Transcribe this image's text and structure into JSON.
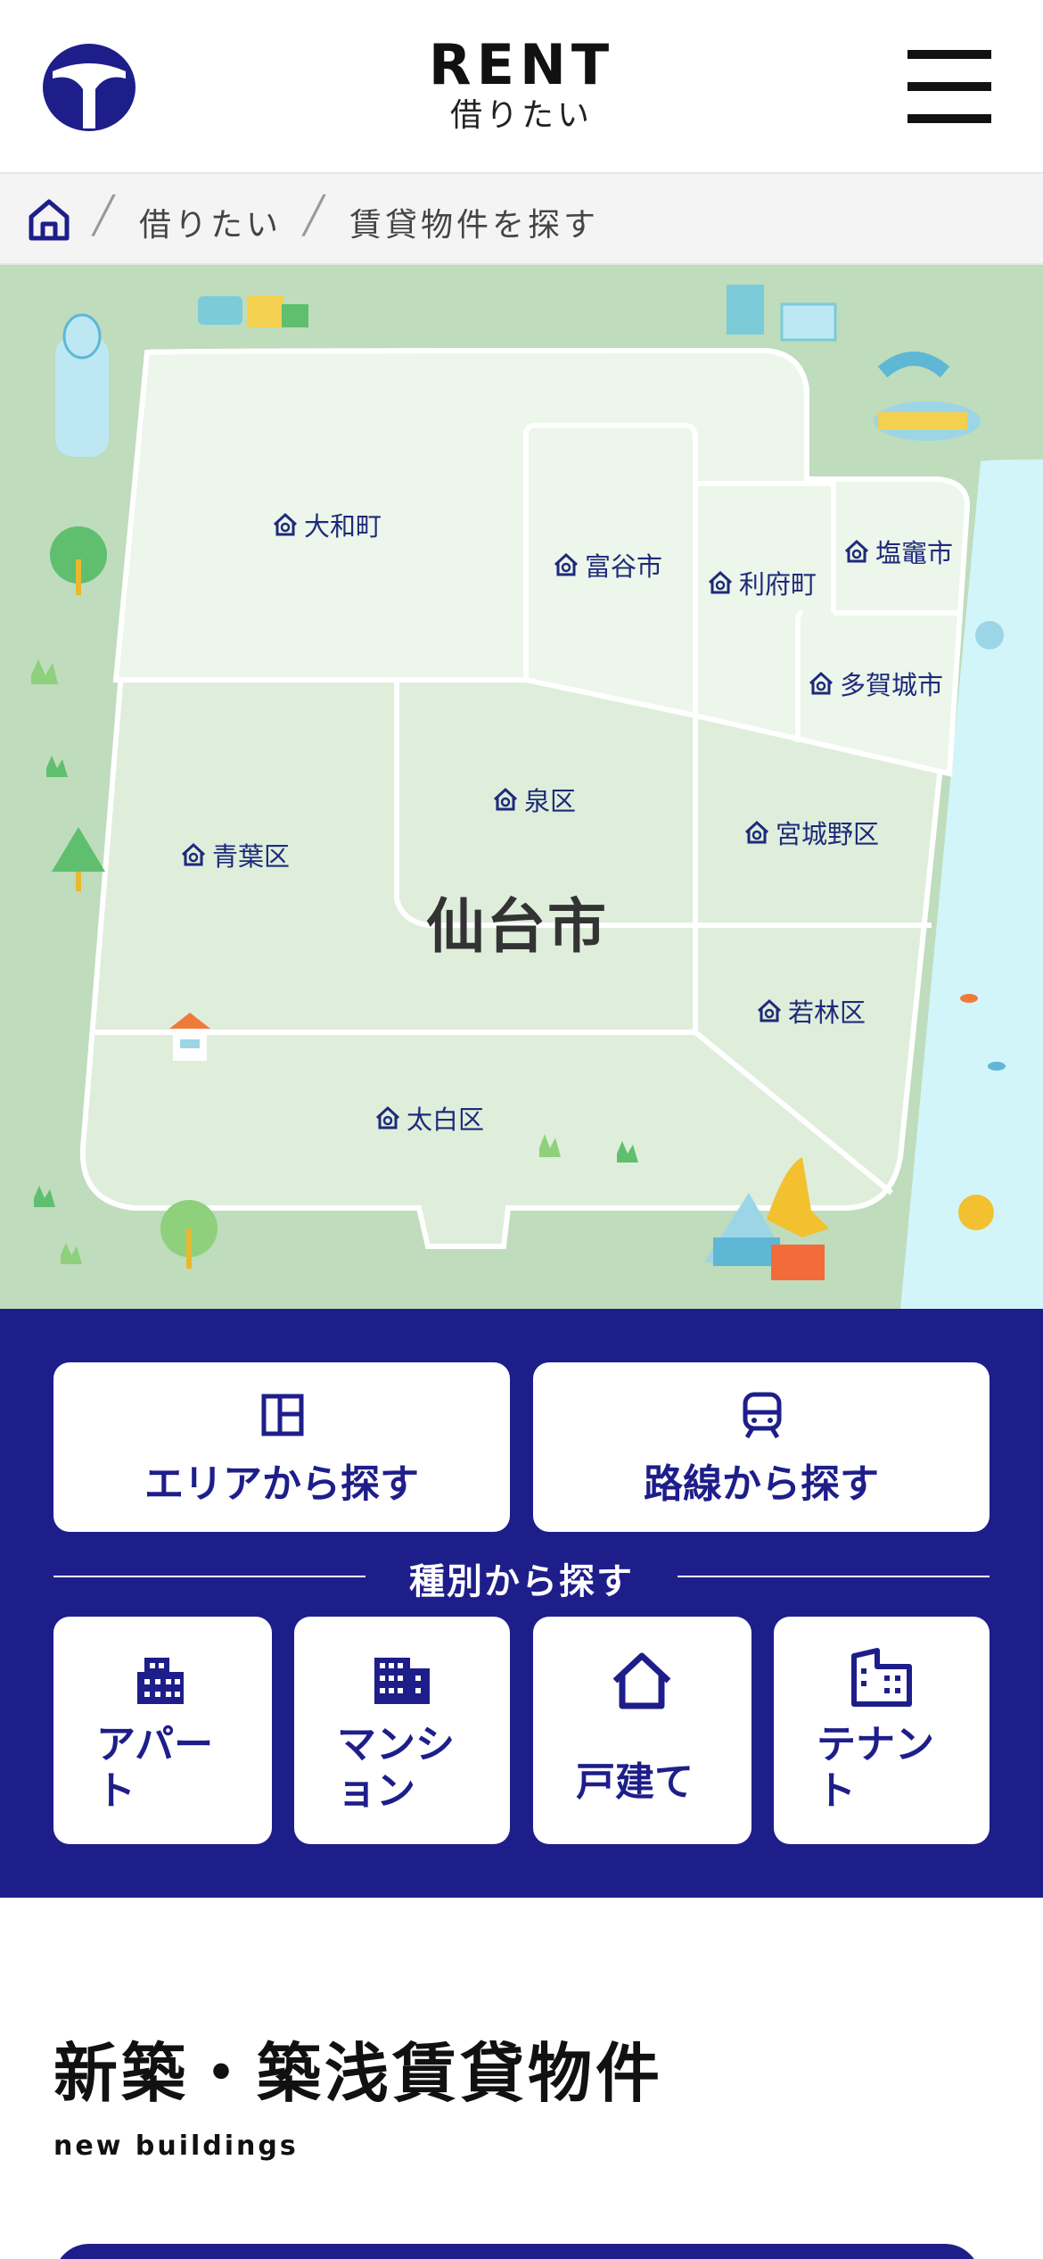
{
  "header": {
    "title": "RENT",
    "subtitle": "借りたい"
  },
  "breadcrumb": {
    "items": [
      "借りたい",
      "賃貸物件を探す"
    ]
  },
  "map": {
    "city": "仙台市",
    "areas": [
      "大和町",
      "富谷市",
      "利府町",
      "塩竈市",
      "多賀城市",
      "泉区",
      "宮城野区",
      "青葉区",
      "若林区",
      "太白区"
    ]
  },
  "search": {
    "area_label": "エリアから探す",
    "line_label": "路線から探す",
    "type_heading": "種別から探す",
    "types": [
      {
        "line1": "アパー",
        "line2": "ト"
      },
      {
        "line1": "マンシ",
        "line2": "ョン"
      },
      {
        "line1": "戸建て",
        "line2": ""
      },
      {
        "line1": "テナン",
        "line2": "ト"
      }
    ]
  },
  "section": {
    "title": "新築・築浅賃貸物件",
    "subtitle": "new buildings"
  },
  "colors": {
    "brand": "#1e1e8a",
    "map_bg": "#bfdcbc",
    "sea": "#d2f5fa"
  }
}
